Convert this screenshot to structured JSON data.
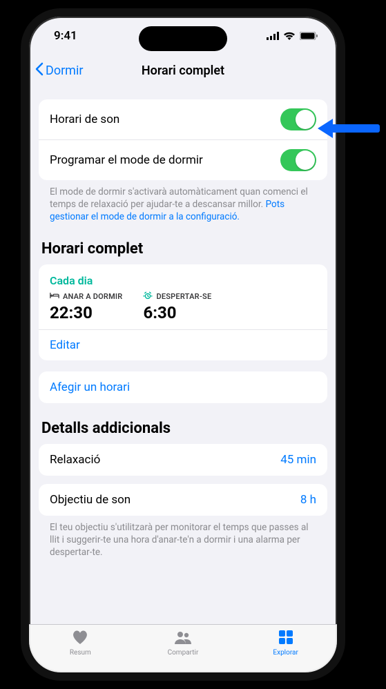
{
  "status": {
    "time": "9:41"
  },
  "nav": {
    "back": "Dormir",
    "title": "Horari complet"
  },
  "toggles": {
    "sleep_schedule": "Horari de son",
    "schedule_focus": "Programar el mode de dormir"
  },
  "focus_note": {
    "text": "El mode de dormir s'activarà automàticament quan comenci el temps de relaxació per ajudar-te a descansar millor. ",
    "link": "Pots gestionar el mode de dormir a la configuració."
  },
  "full_schedule": {
    "header": "Horari complet",
    "every_day": "Cada dia",
    "bedtime_label": "ANAR A DORMIR",
    "bedtime_value": "22:30",
    "wake_label": "DESPERTAR-SE",
    "wake_value": "6:30",
    "edit": "Editar",
    "add": "Afegir un horari"
  },
  "details": {
    "header": "Detalls addicionals",
    "wind_down_label": "Relaxació",
    "wind_down_value": "45 min",
    "goal_label": "Objectiu de son",
    "goal_value": "8 h",
    "goal_note": "El teu objectiu s'utilitzarà per monitorar el temps que passes al llit i suggerir-te una hora d'anar-te'n a dormir i una alarma per despertar-te."
  },
  "tabs": {
    "summary": "Resum",
    "share": "Compartir",
    "browse": "Explorar"
  }
}
